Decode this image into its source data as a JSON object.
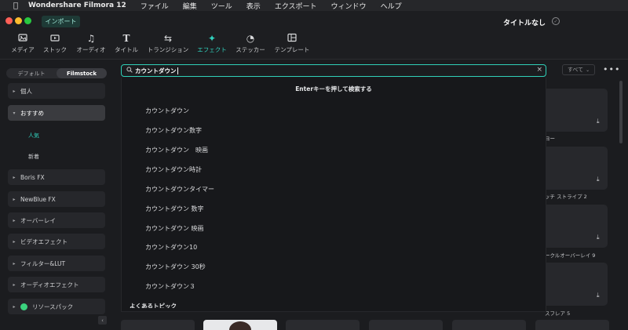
{
  "menubar": {
    "app_name": "Wondershare Filmora 12",
    "items": [
      "ファイル",
      "編集",
      "ツール",
      "表示",
      "エクスポート",
      "ウィンドウ",
      "ヘルプ"
    ]
  },
  "titlebar": {
    "import_label": "インポート",
    "title": "タイトルなし"
  },
  "toolbar": {
    "items": [
      {
        "label": "メディア",
        "icon": "media-icon"
      },
      {
        "label": "ストック",
        "icon": "stock-icon"
      },
      {
        "label": "オーディオ",
        "icon": "audio-icon"
      },
      {
        "label": "タイトル",
        "icon": "title-icon"
      },
      {
        "label": "トランジション",
        "icon": "transition-icon"
      },
      {
        "label": "エフェクト",
        "icon": "effects-icon",
        "active": true
      },
      {
        "label": "ステッカー",
        "icon": "sticker-icon"
      },
      {
        "label": "テンプレート",
        "icon": "template-icon"
      }
    ]
  },
  "sidebar": {
    "tabs": [
      "デフォルト",
      "Filmstock"
    ],
    "active_tab": "Filmstock",
    "categories": [
      {
        "label": "個人"
      },
      {
        "label": "おすすめ",
        "expanded": true
      },
      {
        "label": "Boris FX"
      },
      {
        "label": "NewBlue FX"
      },
      {
        "label": "オーバーレイ"
      },
      {
        "label": "ビデオエフェクト"
      },
      {
        "label": "フィルター&LUT"
      },
      {
        "label": "オーディオエフェクト"
      },
      {
        "label": "リソースパック"
      }
    ],
    "subcategories": [
      {
        "label": "人気",
        "active": true
      },
      {
        "label": "新着"
      }
    ]
  },
  "search": {
    "value": "カウントダウン",
    "filter_label": "すべて"
  },
  "dropdown": {
    "hint": "Enterキーを押して検索する",
    "suggestions": [
      "カウントダウン",
      "カウントダウン数字",
      "カウントダウン　映画",
      "カウントダウン時計",
      "カウントダウンタイマー",
      "カウントダウン 数字",
      "カウントダウン 映画",
      "カウントダウン10",
      "カウントダウン 30秒",
      "カウントダウン３"
    ],
    "section_title": "よくあるトピック"
  },
  "results": {
    "labels": [
      "ヨー",
      "ッチ ストライプ 2",
      "ークルオーバーレイ 9",
      "スフレア 5"
    ]
  },
  "colors": {
    "accent": "#31d1bd",
    "background": "#1b1c1f",
    "close_light": "#fe5f57",
    "minimize_light": "#febc2e",
    "zoom_light": "#28c840"
  }
}
